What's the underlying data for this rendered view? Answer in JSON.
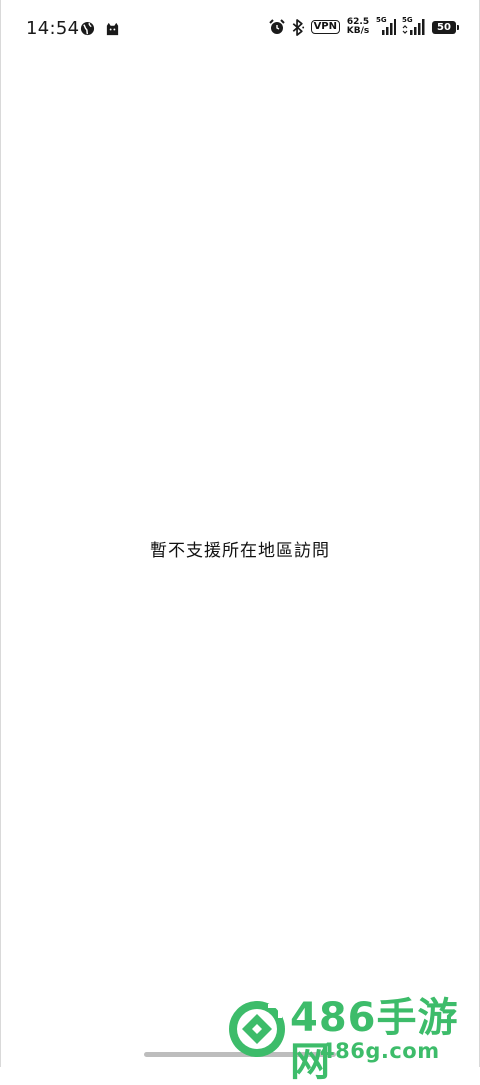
{
  "status_bar": {
    "time": "14:54",
    "vpn_label": "VPN",
    "net_speed_value": "62.5",
    "net_speed_unit": "KB/s",
    "sim1_label": "5G",
    "sim2_label": "5G",
    "battery": "50",
    "icons": [
      "globe-icon",
      "cat-notification-icon",
      "alarm-icon",
      "bluetooth-icon",
      "signal-icon",
      "signal-icon",
      "battery-icon"
    ]
  },
  "main": {
    "message": "暫不支援所在地區訪問"
  },
  "watermark": {
    "title": "486手游网",
    "url": "486g.com",
    "color": "#3dbc6a"
  }
}
